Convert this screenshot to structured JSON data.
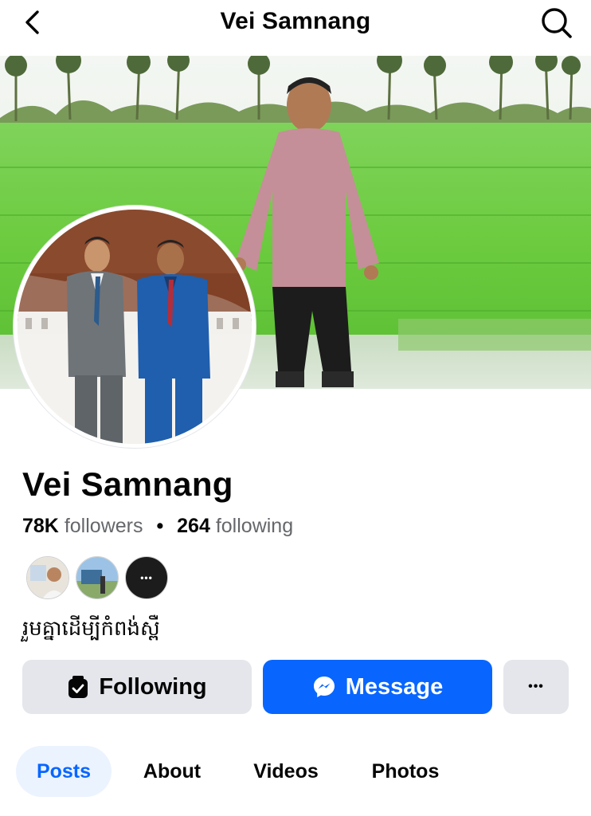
{
  "header": {
    "title": "Vei Samnang",
    "back_icon": "chevron-left-icon",
    "search_icon": "search-icon"
  },
  "profile": {
    "name": "Vei Samnang",
    "followers_count": "78K",
    "followers_label": "followers",
    "following_count": "264",
    "following_label": "following",
    "separator": "•",
    "bio": "រួមគ្នាដើម្បីកំពង់ស្ពឺ"
  },
  "mutual_friends": [
    {
      "icon": "friend-avatar"
    },
    {
      "icon": "friend-avatar"
    },
    {
      "icon": "more-dots-icon",
      "label": "•••"
    }
  ],
  "actions": {
    "following_label": "Following",
    "message_label": "Message",
    "more_label": "•••"
  },
  "tabs": [
    {
      "label": "Posts",
      "active": true
    },
    {
      "label": "About",
      "active": false
    },
    {
      "label": "Videos",
      "active": false
    },
    {
      "label": "Photos",
      "active": false
    }
  ],
  "colors": {
    "accent": "#0866ff",
    "button_gray": "#e4e6eb",
    "active_tab_bg": "#ebf3ff",
    "secondary_text": "#65676b"
  }
}
